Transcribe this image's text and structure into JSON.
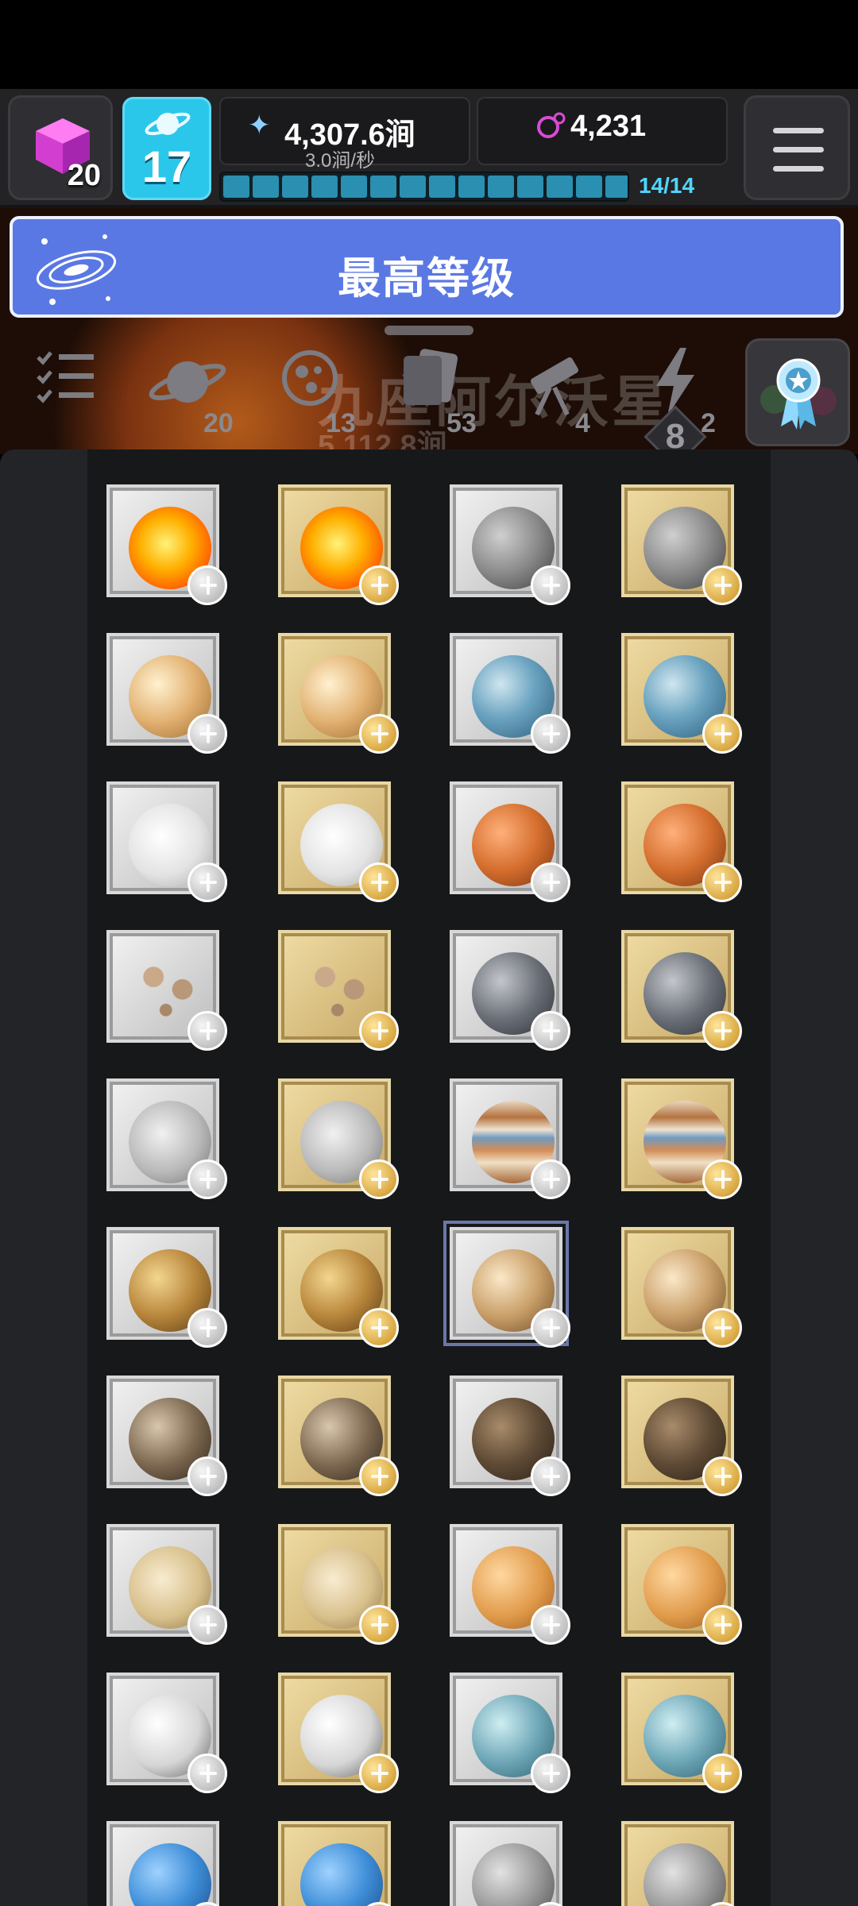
{
  "hud": {
    "cube_count": "20",
    "level": "17",
    "stardust_value": "4,307.6涧",
    "stardust_rate": "3.0涧/秒",
    "gem_value": "4,231",
    "progress_text": "14/14",
    "progress_fraction": 1.0
  },
  "banner": {
    "text": "最高等级"
  },
  "tabs": {
    "ghost_title": "九座阿尔沃星",
    "ghost_sub": "5,112.8涧",
    "planets_count": "20",
    "moons_count": "13",
    "cards_count": "53",
    "telescope_count": "4",
    "boost_count": "2",
    "level_badge": "8"
  },
  "colors": {
    "hud_bg": "#232326",
    "level_bg": "#2bc7ea",
    "banner_bg": "#5a78e4",
    "progress_text": "#4fd6ff",
    "gem_accent": "#d94bd6"
  },
  "grid": {
    "columns": 4,
    "rows": [
      [
        {
          "planet": "sun",
          "tier": "silver"
        },
        {
          "planet": "sun",
          "tier": "gold"
        },
        {
          "planet": "mercury",
          "tier": "silver"
        },
        {
          "planet": "mercury",
          "tier": "gold"
        }
      ],
      [
        {
          "planet": "venus",
          "tier": "silver"
        },
        {
          "planet": "venus",
          "tier": "gold"
        },
        {
          "planet": "earth",
          "tier": "silver"
        },
        {
          "planet": "earth",
          "tier": "gold"
        }
      ],
      [
        {
          "planet": "moon",
          "tier": "silver"
        },
        {
          "planet": "moon",
          "tier": "gold"
        },
        {
          "planet": "mars",
          "tier": "silver"
        },
        {
          "planet": "mars",
          "tier": "gold"
        }
      ],
      [
        {
          "planet": "asteroids",
          "tier": "silver"
        },
        {
          "planet": "asteroids",
          "tier": "gold"
        },
        {
          "planet": "grey-planet",
          "tier": "silver"
        },
        {
          "planet": "grey-planet",
          "tier": "gold"
        }
      ],
      [
        {
          "planet": "rock",
          "tier": "silver"
        },
        {
          "planet": "rock",
          "tier": "gold"
        },
        {
          "planet": "jupiter",
          "tier": "silver"
        },
        {
          "planet": "jupiter",
          "tier": "gold"
        }
      ],
      [
        {
          "planet": "io",
          "tier": "silver"
        },
        {
          "planet": "io",
          "tier": "gold"
        },
        {
          "planet": "europa",
          "tier": "silver",
          "selected": true
        },
        {
          "planet": "europa",
          "tier": "gold"
        }
      ],
      [
        {
          "planet": "ganymede",
          "tier": "silver"
        },
        {
          "planet": "ganymede",
          "tier": "gold"
        },
        {
          "planet": "callisto",
          "tier": "silver"
        },
        {
          "planet": "callisto",
          "tier": "gold"
        }
      ],
      [
        {
          "planet": "saturn",
          "tier": "silver"
        },
        {
          "planet": "saturn",
          "tier": "gold"
        },
        {
          "planet": "orange-moon",
          "tier": "silver"
        },
        {
          "planet": "orange-moon",
          "tier": "gold"
        }
      ],
      [
        {
          "planet": "white-moon",
          "tier": "silver"
        },
        {
          "planet": "white-moon",
          "tier": "gold"
        },
        {
          "planet": "uranus",
          "tier": "silver"
        },
        {
          "planet": "uranus",
          "tier": "gold"
        }
      ],
      [
        {
          "planet": "neptune",
          "tier": "silver"
        },
        {
          "planet": "neptune",
          "tier": "gold"
        },
        {
          "planet": "grey-moon",
          "tier": "silver"
        },
        {
          "planet": "grey-moon",
          "tier": "gold"
        }
      ]
    ]
  }
}
